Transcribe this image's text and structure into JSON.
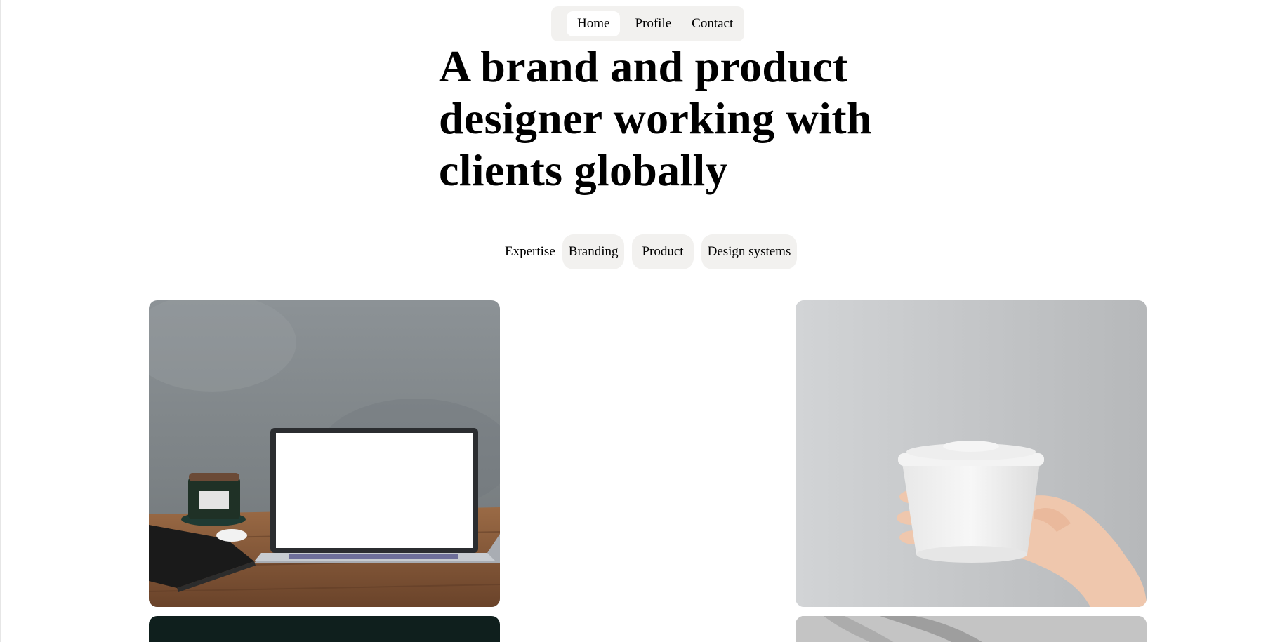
{
  "nav": {
    "items": [
      {
        "label": "Home",
        "active": true
      },
      {
        "label": "Profile",
        "active": false
      },
      {
        "label": "Contact",
        "active": false
      }
    ]
  },
  "hero": {
    "line1": "A brand and product",
    "line2": "designer working with",
    "line3": "clients globally"
  },
  "expertise": {
    "label": "Expertise",
    "chips": [
      "Branding",
      "Product",
      "Design systems"
    ]
  },
  "gallery": {
    "images": [
      {
        "subject": "laptop-on-wooden-desk"
      },
      {
        "subject": "hand-holding-white-cup"
      },
      {
        "subject": "dark-green-photo"
      },
      {
        "subject": "grey-shadow-photo"
      }
    ]
  },
  "colors": {
    "pill_bg": "#f2f1ef",
    "page_bg": "#ffffff",
    "text": "#000000"
  }
}
